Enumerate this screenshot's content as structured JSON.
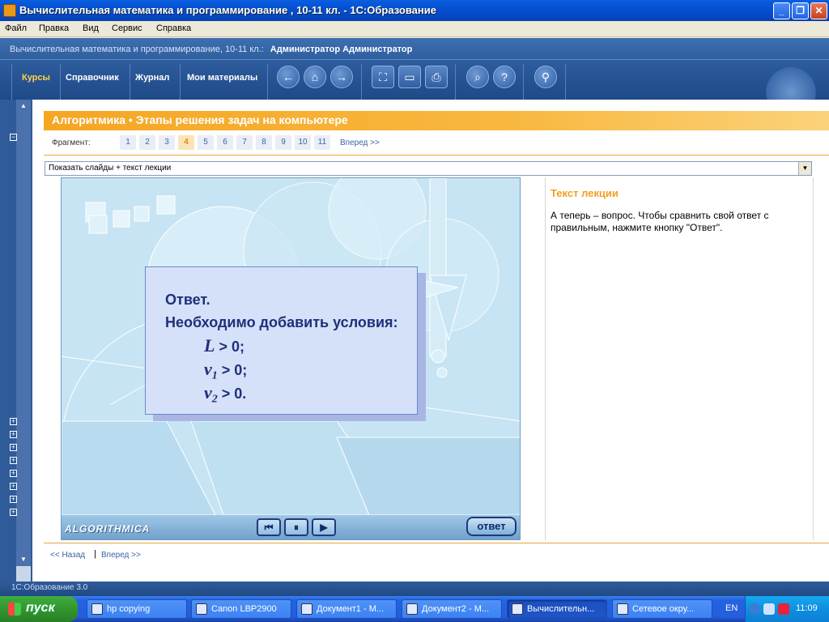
{
  "window": {
    "title": "Вычислительная математика и программирование , 10-11 кл. - 1С:Образование",
    "minimize": "_",
    "maximize": "❐",
    "close": "✕"
  },
  "menu": [
    "Файл",
    "Правка",
    "Вид",
    "Сервис",
    "Справка"
  ],
  "header": {
    "course": "Вычислительная математика и программирование, 10-11 кл.:",
    "user": "Администратор Администратор",
    "tabs": [
      "Курсы",
      "Справочник",
      "Журнал",
      "Мои материалы"
    ],
    "active_tab": "Курсы",
    "tools": [
      {
        "icon": "arrow-left-icon",
        "glyph": "←"
      },
      {
        "icon": "home-icon",
        "glyph": "⌂"
      },
      {
        "icon": "arrow-right-icon",
        "glyph": "→"
      },
      {
        "icon": "fullscreen-icon",
        "glyph": "⛶"
      },
      {
        "icon": "presentation-icon",
        "glyph": "▭"
      },
      {
        "icon": "print-icon",
        "glyph": "⎙"
      },
      {
        "icon": "search-icon",
        "glyph": "⌕"
      },
      {
        "icon": "help-icon",
        "glyph": "?"
      },
      {
        "icon": "key-search-icon",
        "glyph": "⚲"
      }
    ]
  },
  "lesson": {
    "title": "Алгоритмика • Этапы решения задач на компьютере",
    "fragment_label": "Фрагмент:",
    "fragments": [
      "1",
      "2",
      "3",
      "4",
      "5",
      "6",
      "7",
      "8",
      "9",
      "10",
      "11"
    ],
    "active_fragment": "4",
    "next_link": "Вперед >>",
    "view_mode": "Показать слайды + текст лекции"
  },
  "slide": {
    "answer_title": "Ответ.",
    "answer_text": "Необходимо добавить условия:",
    "conditions": [
      {
        "var": "L",
        "rest": " > 0;"
      },
      {
        "var": "v",
        "sub": "1",
        "rest": " > 0;"
      },
      {
        "var": "v",
        "sub": "2",
        "rest": " > 0."
      }
    ],
    "brand": "ALGORITHMICA",
    "answer_button": "ответ",
    "controls": [
      "⏮",
      "⏸",
      "▶"
    ]
  },
  "lecture": {
    "title": "Текст лекции",
    "text": "А теперь – вопрос. Чтобы сравнить свой ответ с правильным, нажмите кнопку \"Ответ\"."
  },
  "footer_nav": {
    "back": "<< Назад",
    "separator": "|",
    "next": "Вперед >>"
  },
  "statusbar": "1С:Образование 3.0",
  "taskbar": {
    "start": "пуск",
    "tasks": [
      {
        "label": "hp copying",
        "active": false
      },
      {
        "label": "Canon LBP2900",
        "active": false
      },
      {
        "label": "Документ1 - М...",
        "active": false
      },
      {
        "label": "Документ2 - М...",
        "active": false
      },
      {
        "label": "Вычислительн...",
        "active": true
      },
      {
        "label": "Сетевое окру...",
        "active": false
      }
    ],
    "lang": "EN",
    "clock": "11:09"
  },
  "colors": {
    "accent": "#f5a623",
    "header": "#2a5898",
    "link": "#3a63a4",
    "slide_text": "#1f2f7a"
  }
}
